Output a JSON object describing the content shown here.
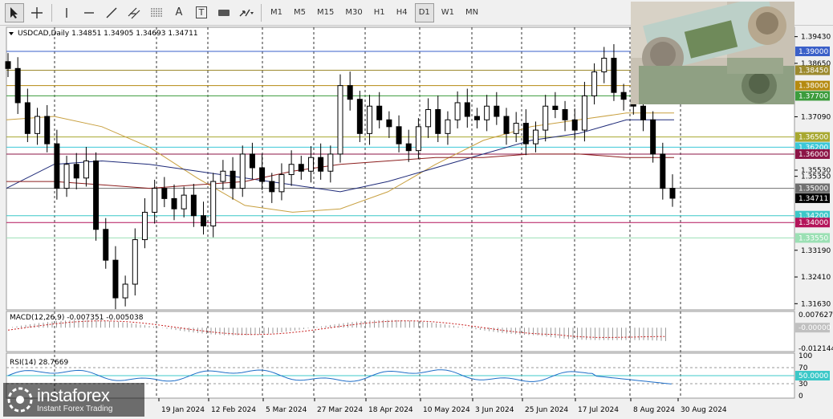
{
  "toolbar": {
    "tools": [
      {
        "name": "cursor",
        "icon": "arrow-cursor-icon",
        "active": true
      },
      {
        "name": "crosshair",
        "icon": "crosshair-icon"
      },
      {
        "name": "vertical-line",
        "icon": "vertical-line-icon"
      },
      {
        "name": "horizontal-line",
        "icon": "horizontal-line-icon"
      },
      {
        "name": "trend-line",
        "icon": "trend-line-icon"
      },
      {
        "name": "channel",
        "icon": "channel-icon"
      },
      {
        "name": "fibonacci",
        "icon": "fibonacci-icon"
      },
      {
        "name": "text",
        "icon": "text-icon",
        "label": "A"
      },
      {
        "name": "text-label",
        "icon": "text-label-icon",
        "label": "T"
      },
      {
        "name": "rectangle",
        "icon": "rectangle-icon"
      },
      {
        "name": "arrows",
        "icon": "arrows-icon"
      }
    ],
    "timeframes": [
      "M1",
      "M5",
      "M15",
      "M30",
      "H1",
      "H4",
      "D1",
      "W1",
      "MN"
    ],
    "active_timeframe": "D1"
  },
  "chart": {
    "symbol_line": "USDCAD,Daily  1.34851 1.34905 1.34693 1.34711",
    "price_labels": [
      {
        "text": "1.39430",
        "value": 1.3943,
        "type": "plain"
      },
      {
        "text": "1.39000",
        "value": 1.39,
        "type": "box",
        "color": "#3a5fc8"
      },
      {
        "text": "1.38650",
        "value": 1.3865,
        "type": "plain"
      },
      {
        "text": "1.38450",
        "value": 1.3845,
        "type": "box",
        "color": "#9c8a2e"
      },
      {
        "text": "1.38000",
        "value": 1.38,
        "type": "box",
        "color": "#b58a10"
      },
      {
        "text": "1.37700",
        "value": 1.377,
        "type": "box",
        "color": "#3c9c3c"
      },
      {
        "text": "1.37090",
        "value": 1.3709,
        "type": "plain"
      },
      {
        "text": "1.36500",
        "value": 1.365,
        "type": "box",
        "color": "#a8a830"
      },
      {
        "text": "1.36200",
        "value": 1.362,
        "type": "box",
        "color": "#3cc8d8"
      },
      {
        "text": "1.36000",
        "value": 1.36,
        "type": "box",
        "color": "#8c1446"
      },
      {
        "text": "1.35530",
        "value": 1.3553,
        "type": "plain"
      },
      {
        "text": "1.35350",
        "value": 1.3535,
        "type": "plain"
      },
      {
        "text": "1.35000",
        "value": 1.35,
        "type": "box",
        "color": "#707070"
      },
      {
        "text": "1.34711",
        "value": 1.34711,
        "type": "box",
        "color": "#000000"
      },
      {
        "text": "1.34200",
        "value": 1.342,
        "type": "box",
        "color": "#3cc8c8"
      },
      {
        "text": "1.34000",
        "value": 1.34,
        "type": "box",
        "color": "#b4145a"
      },
      {
        "text": "1.33550",
        "value": 1.3355,
        "type": "box",
        "color": "#9be0b4"
      },
      {
        "text": "1.33190",
        "value": 1.3319,
        "type": "plain"
      },
      {
        "text": "1.32410",
        "value": 1.3241,
        "type": "plain"
      },
      {
        "text": "1.31630",
        "value": 1.3163,
        "type": "plain"
      }
    ],
    "date_labels": [
      "19 Jan 2024",
      "12 Feb 2024",
      "5 Mar 2024",
      "27 Mar 2024",
      "18 Apr 2024",
      "10 May 2024",
      "3 Jun 2024",
      "25 Jun 2024",
      "17 Jul 2024",
      "8 Aug 2024",
      "30 Aug 2024"
    ]
  },
  "macd": {
    "label": "MACD(12,26,9) -0.007351 -0.005038",
    "scale": [
      {
        "text": "0.007627",
        "value": 0.007627,
        "type": "plain"
      },
      {
        "text": "-0.00000",
        "value": 0.0,
        "type": "box",
        "color": "#c0c0c0"
      },
      {
        "text": "-0.012144",
        "value": -0.012144,
        "type": "plain"
      }
    ]
  },
  "rsi": {
    "label": "RSI(14) 28.7669",
    "scale": [
      {
        "text": "100",
        "value": 100,
        "type": "plain"
      },
      {
        "text": "70",
        "value": 70,
        "type": "plain"
      },
      {
        "text": "50.0000",
        "value": 50,
        "type": "box",
        "color": "#3cc8c8"
      },
      {
        "text": "30",
        "value": 30,
        "type": "plain"
      },
      {
        "text": "0",
        "value": 0,
        "type": "plain"
      }
    ]
  },
  "watermark": {
    "name": "instaforex",
    "sub": "Instant Forex Trading"
  },
  "chart_data": {
    "type": "candlestick",
    "symbol": "USDCAD",
    "timeframe": "Daily",
    "last_bar": {
      "open": 1.34851,
      "high": 1.34905,
      "low": 1.34693,
      "close": 1.34711
    },
    "x_ticks": [
      "19 Jan 2024",
      "12 Feb 2024",
      "5 Mar 2024",
      "27 Mar 2024",
      "18 Apr 2024",
      "10 May 2024",
      "3 Jun 2024",
      "25 Jun 2024",
      "17 Jul 2024",
      "8 Aug 2024",
      "30 Aug 2024"
    ],
    "ylim": [
      1.3145,
      1.3975
    ],
    "close_path": [
      1.385,
      1.375,
      1.366,
      1.371,
      1.363,
      1.35,
      1.357,
      1.353,
      1.358,
      1.338,
      1.329,
      1.318,
      1.322,
      1.335,
      1.343,
      1.35,
      1.347,
      1.344,
      1.348,
      1.342,
      1.339,
      1.352,
      1.355,
      1.35,
      1.36,
      1.356,
      1.352,
      1.349,
      1.354,
      1.357,
      1.355,
      1.359,
      1.355,
      1.36,
      1.38,
      1.376,
      1.366,
      1.374,
      1.37,
      1.368,
      1.363,
      1.361,
      1.368,
      1.373,
      1.366,
      1.37,
      1.375,
      1.371,
      1.37,
      1.374,
      1.371,
      1.366,
      1.369,
      1.363,
      1.367,
      1.374,
      1.373,
      1.37,
      1.367,
      1.377,
      1.384,
      1.388,
      1.378,
      1.376,
      1.374,
      1.37,
      1.36,
      1.35,
      1.3471
    ],
    "horizontal_levels": [
      1.39,
      1.3845,
      1.38,
      1.377,
      1.365,
      1.362,
      1.36,
      1.35,
      1.342,
      1.34,
      1.3355
    ],
    "moving_averages": [
      {
        "color": "#c8a040",
        "points": [
          1.37,
          1.371,
          1.368,
          1.362,
          1.353,
          1.345,
          1.343,
          1.344,
          1.349,
          1.357,
          1.364,
          1.368,
          1.37,
          1.372,
          1.372
        ]
      },
      {
        "color": "#1e2a78",
        "points": [
          1.35,
          1.357,
          1.358,
          1.357,
          1.355,
          1.353,
          1.351,
          1.349,
          1.352,
          1.356,
          1.36,
          1.364,
          1.366,
          1.37,
          1.37
        ]
      },
      {
        "color": "#8c1e1e",
        "points": [
          1.352,
          1.352,
          1.351,
          1.35,
          1.351,
          1.352,
          1.355,
          1.357,
          1.358,
          1.359,
          1.359,
          1.36,
          1.36,
          1.359,
          1.359
        ]
      }
    ],
    "macd": {
      "value": -0.007351,
      "signal": -0.005038,
      "ylim": [
        -0.012144,
        0.007627
      ]
    },
    "rsi": {
      "value": 28.7669,
      "levels": [
        30,
        50,
        70
      ],
      "ylim": [
        0,
        100
      ]
    }
  }
}
